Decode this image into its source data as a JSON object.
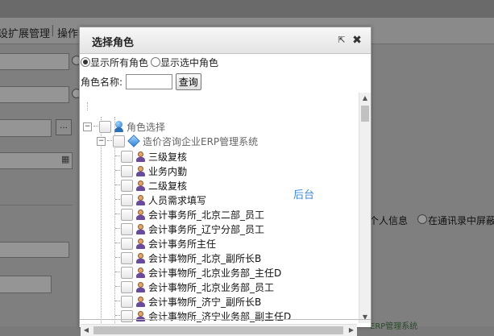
{
  "background": {
    "menu_items": [
      "设扩展管理",
      "操作"
    ],
    "right_text": {
      "option_a": "个人信息",
      "option_b": "在通讯录中屏蔽"
    },
    "status_text": "ERP管理系统"
  },
  "dialog": {
    "title": "选择角色",
    "popout_icon": "popout-icon",
    "close_icon": "close-icon",
    "radio_options": [
      {
        "label": "显示所有角色",
        "checked": true
      },
      {
        "label": "显示选中角色",
        "checked": false
      }
    ],
    "search": {
      "label": "角色名称:",
      "value": "",
      "button": "查询"
    },
    "tree": {
      "root": {
        "label": "角色选择",
        "icon": "role-root-icon"
      },
      "system": {
        "label": "造价咨询企业ERP管理系统",
        "icon": "system-icon"
      },
      "roles": [
        "三级复核",
        "业务内勤",
        "二级复核",
        "人员需求填写",
        "会计事务所_北京二部_员工",
        "会计事务所_辽宁分部_员工",
        "会计事务所主任",
        "会计事物所_北京_副所长B",
        "会计事物所_北京业务部_主任D",
        "会计事物所_北京业务部_员工",
        "会计事物所_济宁_副所长B",
        "会计事物所_济宁业务部_副主任D"
      ]
    }
  },
  "overlay_label": "后台",
  "colors": {
    "accent_link": "#3d8ad6",
    "dialog_bg": "#ffffff",
    "overlay_dim": "#7f7f7f"
  }
}
